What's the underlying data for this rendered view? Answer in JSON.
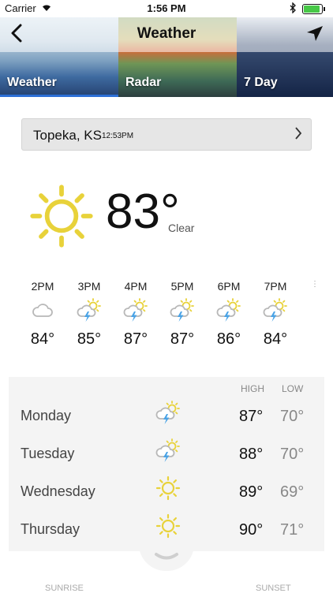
{
  "status_bar": {
    "carrier": "Carrier",
    "time": "1:56 PM"
  },
  "header": {
    "title": "Weather"
  },
  "tabs": [
    {
      "label": "Weather",
      "selected": true
    },
    {
      "label": "Radar",
      "selected": false
    },
    {
      "label": "7 Day",
      "selected": false
    }
  ],
  "accent_color": "#2d6fd6",
  "location": {
    "city": "Topeka, KS",
    "time": "12:53PM"
  },
  "current": {
    "temp": "83°",
    "condition": "Clear",
    "icon": "sun-icon"
  },
  "hourly": [
    {
      "time": "2PM",
      "icon": "cloud-icon",
      "temp": "84°"
    },
    {
      "time": "3PM",
      "icon": "thunderstorm-icon",
      "temp": "85°"
    },
    {
      "time": "4PM",
      "icon": "thunderstorm-icon",
      "temp": "87°"
    },
    {
      "time": "5PM",
      "icon": "thunderstorm-icon",
      "temp": "87°"
    },
    {
      "time": "6PM",
      "icon": "thunderstorm-icon",
      "temp": "86°"
    },
    {
      "time": "7PM",
      "icon": "thunderstorm-icon",
      "temp": "84°"
    }
  ],
  "daily": {
    "high_label": "HIGH",
    "low_label": "LOW",
    "days": [
      {
        "name": "Monday",
        "icon": "thunderstorm-icon",
        "high": "87°",
        "low": "70°"
      },
      {
        "name": "Tuesday",
        "icon": "thunderstorm-icon",
        "high": "88°",
        "low": "70°"
      },
      {
        "name": "Wednesday",
        "icon": "sun-icon",
        "high": "89°",
        "low": "69°"
      },
      {
        "name": "Thursday",
        "icon": "sun-icon",
        "high": "90°",
        "low": "71°"
      }
    ]
  },
  "bottom": {
    "sunrise_label": "SUNRISE",
    "sunset_label": "SUNSET"
  }
}
